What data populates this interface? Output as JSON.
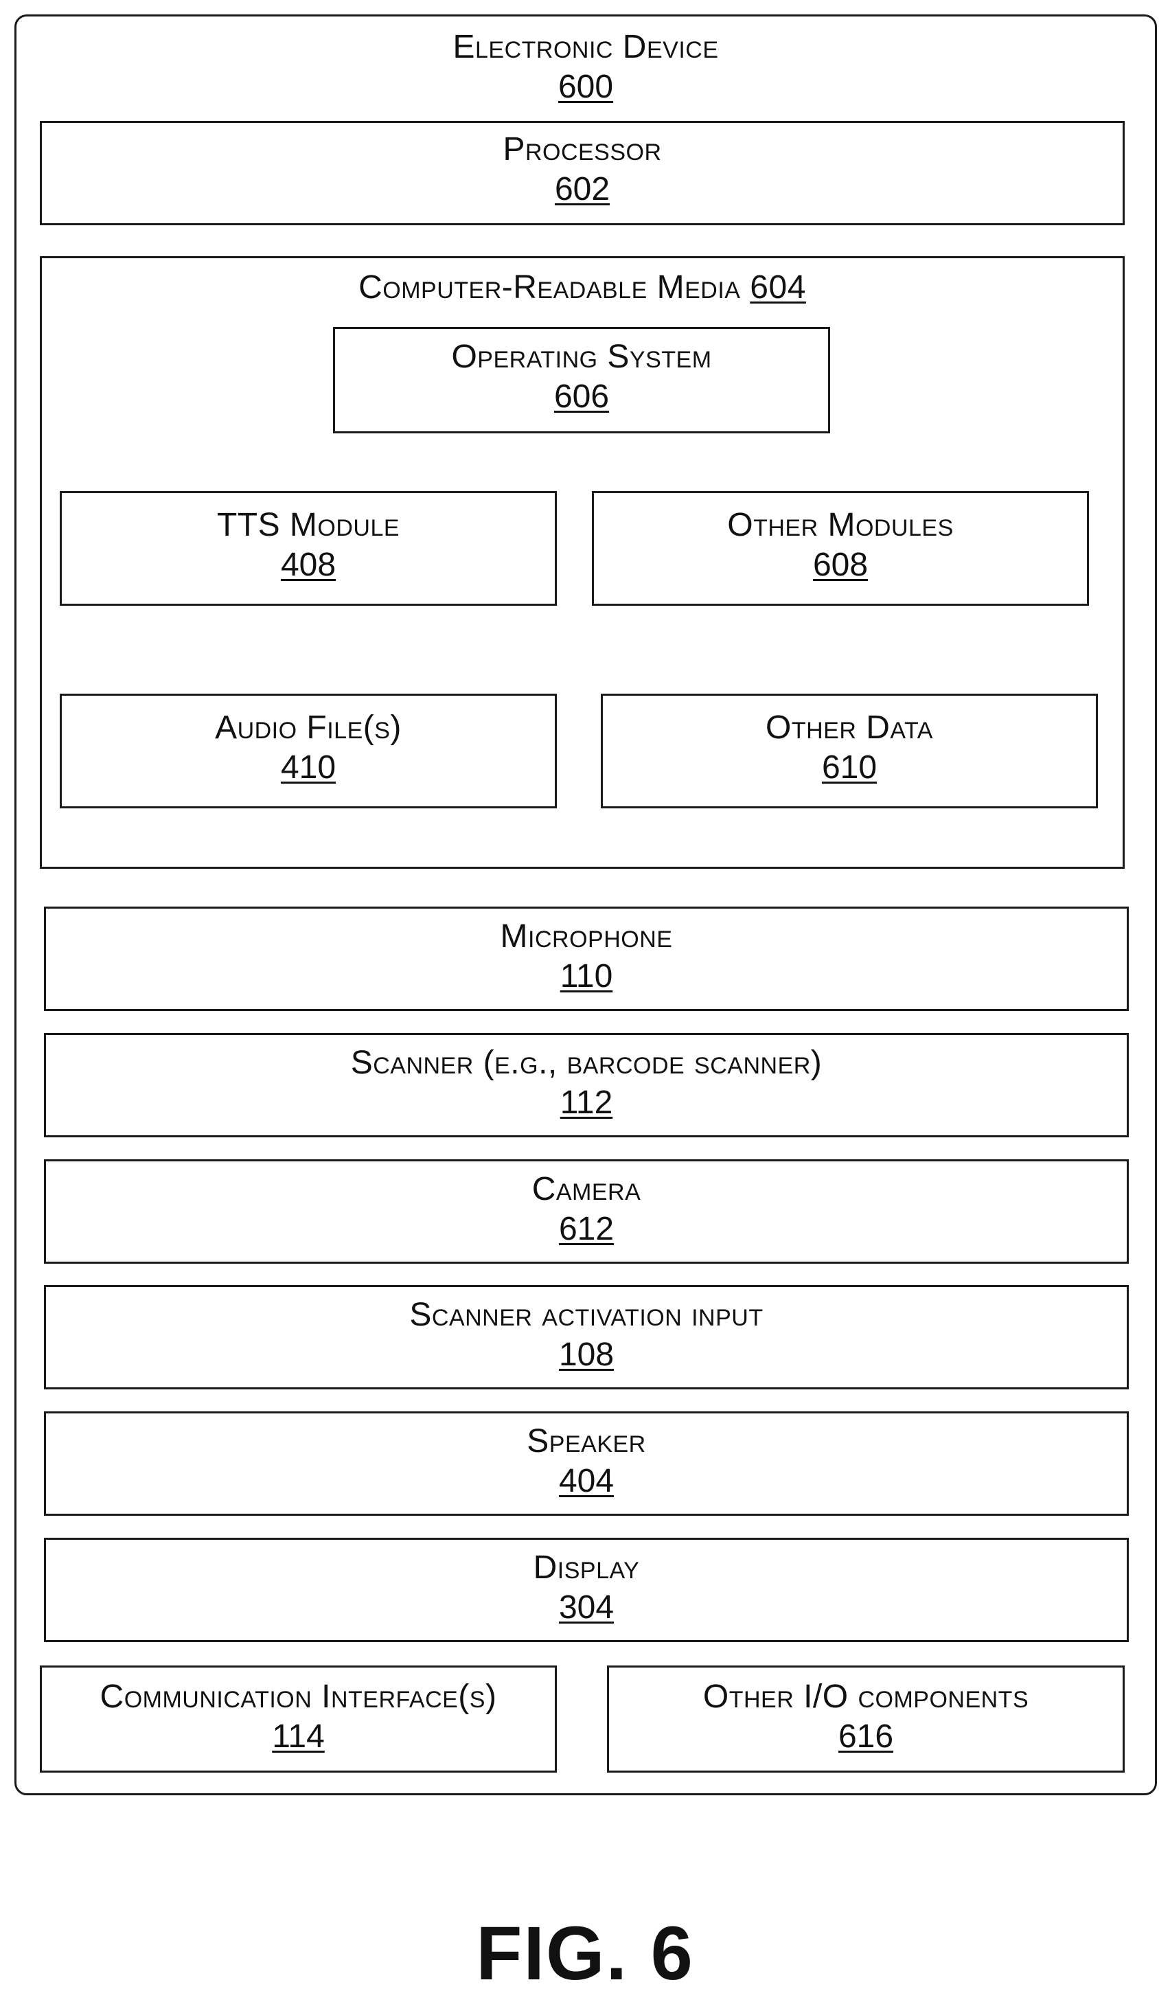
{
  "device": {
    "title": "Electronic Device",
    "number": "600"
  },
  "processor": {
    "title": "Processor",
    "number": "602"
  },
  "crm": {
    "title": "Computer-Readable Media",
    "number": "604",
    "operating_system": {
      "title": "Operating System",
      "number": "606"
    },
    "tts_module": {
      "title": "TTS Module",
      "number": "408"
    },
    "other_modules": {
      "title": "Other Modules",
      "number": "608"
    },
    "audio_files": {
      "title": "Audio File(s)",
      "number": "410"
    },
    "other_data": {
      "title": "Other Data",
      "number": "610"
    }
  },
  "components": [
    {
      "title": "Microphone",
      "number": "110"
    },
    {
      "title": "Scanner (e.g., barcode scanner)",
      "number": "112"
    },
    {
      "title": "Camera",
      "number": "612"
    },
    {
      "title": "Scanner activation input",
      "number": "108"
    },
    {
      "title": "Speaker",
      "number": "404"
    },
    {
      "title": "Display",
      "number": "304"
    }
  ],
  "communication": {
    "title": "Communication Interface(s)",
    "number": "114"
  },
  "other_io": {
    "title": "Other I/O components",
    "number": "616"
  },
  "figure_label": "FIG. 6"
}
